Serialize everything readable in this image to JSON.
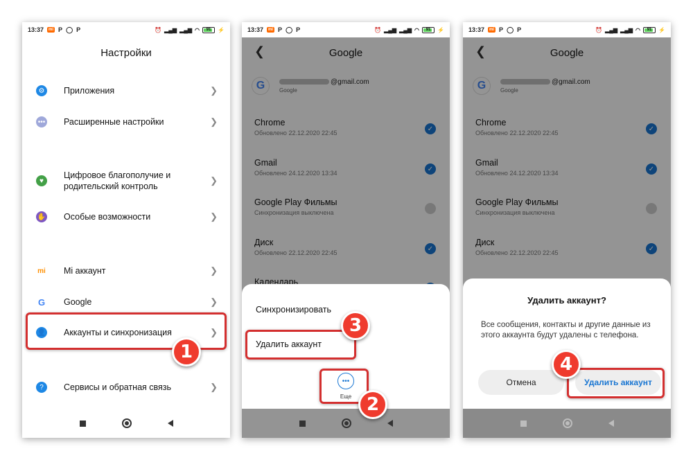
{
  "status": {
    "time": "13:37",
    "battery": "91"
  },
  "screen1": {
    "title": "Настройки",
    "items": [
      {
        "label": "Приложения",
        "icon": "gear-icon",
        "color": "#1e88e5"
      },
      {
        "label": "Расширенные настройки",
        "icon": "dots-icon",
        "color": "#9fa8da"
      },
      {
        "label": "Цифровое благополучие и родительский контроль",
        "icon": "wellbeing-icon",
        "color": "#43a047"
      },
      {
        "label": "Особые возможности",
        "icon": "accessibility-icon",
        "color": "#7e57c2"
      },
      {
        "label": "Mi аккаунт",
        "icon": "mi-icon",
        "color": "#ff8f00"
      },
      {
        "label": "Google",
        "icon": "google-icon",
        "color": "#4285f4"
      },
      {
        "label": "Аккаунты и синхронизация",
        "icon": "user-icon",
        "color": "#1e88e5"
      },
      {
        "label": "Сервисы и обратная связь",
        "icon": "help-icon",
        "color": "#1e88e5"
      }
    ]
  },
  "screen2": {
    "title": "Google",
    "account": {
      "email_suffix": "@gmail.com",
      "provider": "Google"
    },
    "apps": [
      {
        "name": "Chrome",
        "sub": "Обновлено 22.12.2020 22:45",
        "checked": true
      },
      {
        "name": "Gmail",
        "sub": "Обновлено 24.12.2020 13:34",
        "checked": true
      },
      {
        "name": "Google Play Фильмы",
        "sub": "Синхронизация выключена",
        "checked": false
      },
      {
        "name": "Диск",
        "sub": "Обновлено 22.12.2020 22:45",
        "checked": true
      },
      {
        "name": "Календарь",
        "sub": "",
        "checked": true
      }
    ],
    "menu": {
      "sync": "Синхронизировать",
      "delete": "Удалить аккаунт",
      "more": "Еще"
    }
  },
  "screen3": {
    "title": "Google",
    "dialog": {
      "title": "Удалить аккаунт?",
      "body": "Все сообщения, контакты и другие данные из этого аккаунта будут удалены с телефона.",
      "cancel": "Отмена",
      "confirm": "Удалить аккаунт"
    }
  },
  "steps": [
    "1",
    "2",
    "3",
    "4"
  ],
  "colors": {
    "accent": "#1976d2",
    "highlight": "#d32f2f",
    "step_badge": "#ef3b2e"
  }
}
